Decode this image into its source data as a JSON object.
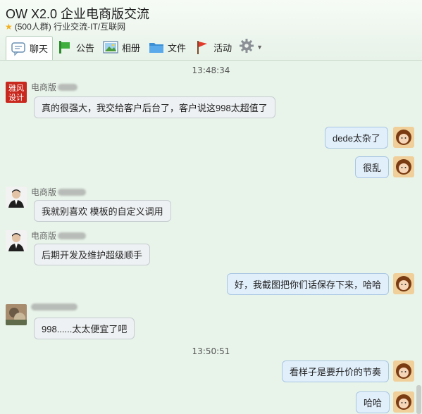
{
  "window": {
    "title": "OW X2.0 企业电商版交流",
    "group_info": "(500人群) 行业交流-IT/互联网"
  },
  "toolbar": {
    "tabs": [
      {
        "label": "聊天",
        "icon": "chat-bubble-icon"
      },
      {
        "label": "公告",
        "icon": "megaphone-icon"
      },
      {
        "label": "相册",
        "icon": "photo-icon"
      },
      {
        "label": "文件",
        "icon": "folder-icon"
      },
      {
        "label": "活动",
        "icon": "flag-icon"
      }
    ],
    "settings_icon": "gear-icon"
  },
  "messages": {
    "ts1": "13:48:34",
    "m1": {
      "sender": "电商版",
      "text": "真的很强大，我交给客户后台了，客户说这998太超值了",
      "avatar_text": "雅风设计"
    },
    "m2": {
      "text": "dede太杂了"
    },
    "m3": {
      "text": "很乱"
    },
    "m4": {
      "sender": "电商版",
      "text": "我就别喜欢 模板的自定义调用"
    },
    "m5": {
      "sender": "电商版",
      "text": "后期开发及维护超级顺手"
    },
    "m6": {
      "text": "好，我截图把你们话保存下来，哈哈"
    },
    "m7": {
      "text": "998......太太便宜了吧"
    },
    "ts2": "13:50:51",
    "m8": {
      "text": "看样子是要升价的节奏"
    },
    "m9": {
      "text": "哈哈"
    }
  },
  "colors": {
    "background": "#e8f4ea",
    "bubble_left": "#eef1f3",
    "bubble_right": "#e1effb",
    "star": "#f2b01e",
    "logo_red": "#c8281e"
  }
}
